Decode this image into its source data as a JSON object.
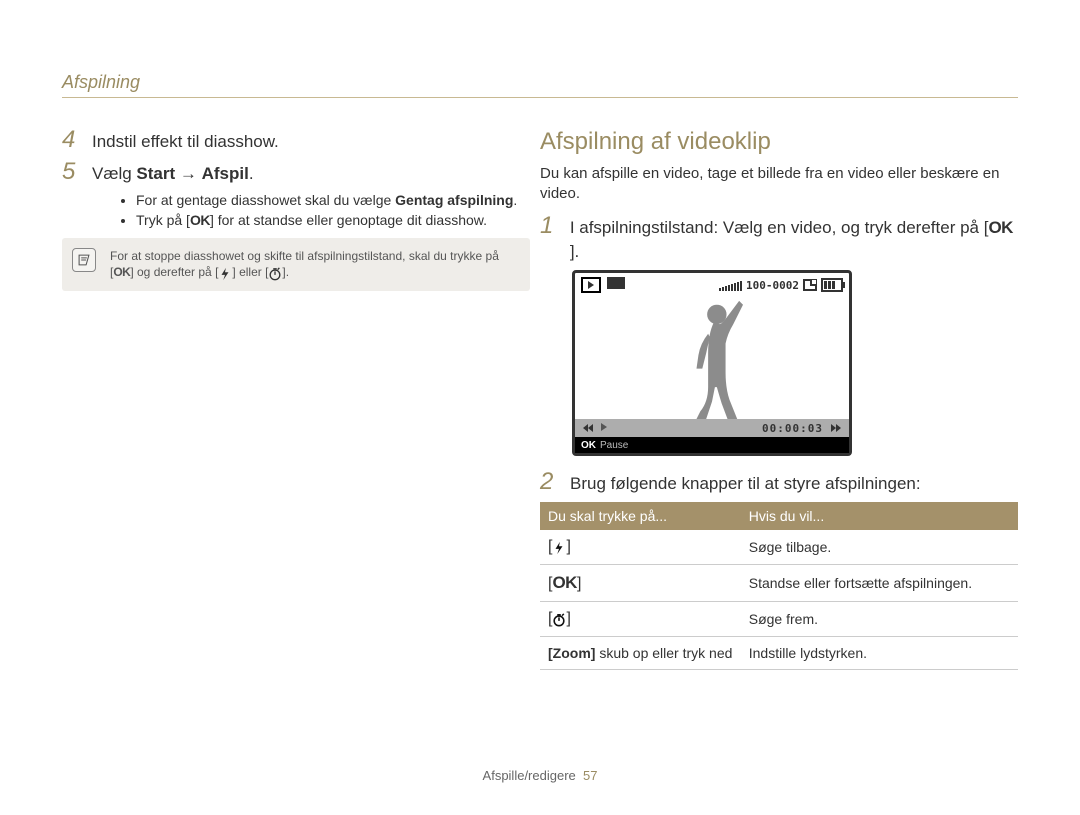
{
  "header": {
    "section": "Afspilning"
  },
  "left": {
    "step4": {
      "num": "4",
      "text": "Indstil effekt til diasshow."
    },
    "step5": {
      "num": "5",
      "prefix": "Vælg ",
      "bold1": "Start",
      "arrow": " → ",
      "bold2": "Afspil",
      "suffix": "."
    },
    "bullet1a": "For at gentage diasshowet skal du vælge ",
    "bullet1b": "Gentag afspilning",
    "bullet1c": ".",
    "bullet2a": "Tryk på [",
    "bullet2_ok": "OK",
    "bullet2b": "] for at standse eller genoptage dit diasshow.",
    "note": {
      "line1": "For at stoppe diasshowet og skifte til afspilningstilstand, skal du trykke på",
      "line2a": "[",
      "line2ok": "OK",
      "line2b": "] og derefter på [",
      "line2c": "] eller [",
      "line2d": "]."
    }
  },
  "right": {
    "heading": "Afspilning af videoklip",
    "intro": "Du kan afspille en video, tage et billede fra en video eller beskære en video.",
    "step1": {
      "num": "1",
      "text_a": "I afspilningstilstand: Vælg en video, og tryk derefter på [",
      "text_b": "]."
    },
    "lcd": {
      "counter": "100-0002",
      "timer": "00:00:03",
      "status": "Pause",
      "status_prefix": "OK"
    },
    "step2": {
      "num": "2",
      "text": "Brug følgende knapper til at styre afspilningen:"
    },
    "table": {
      "h1": "Du skal trykke på...",
      "h2": "Hvis du vil...",
      "r1v": "Søge tilbage.",
      "r2k": "OK",
      "r2v": "Standse eller fortsætte afspilningen.",
      "r3v": "Søge frem.",
      "r4k_a": "[Zoom]",
      "r4k_b": " skub op eller tryk ned",
      "r4v": "Indstille lydstyrken."
    }
  },
  "footer": {
    "label": "Afspille/redigere",
    "page": "57"
  }
}
